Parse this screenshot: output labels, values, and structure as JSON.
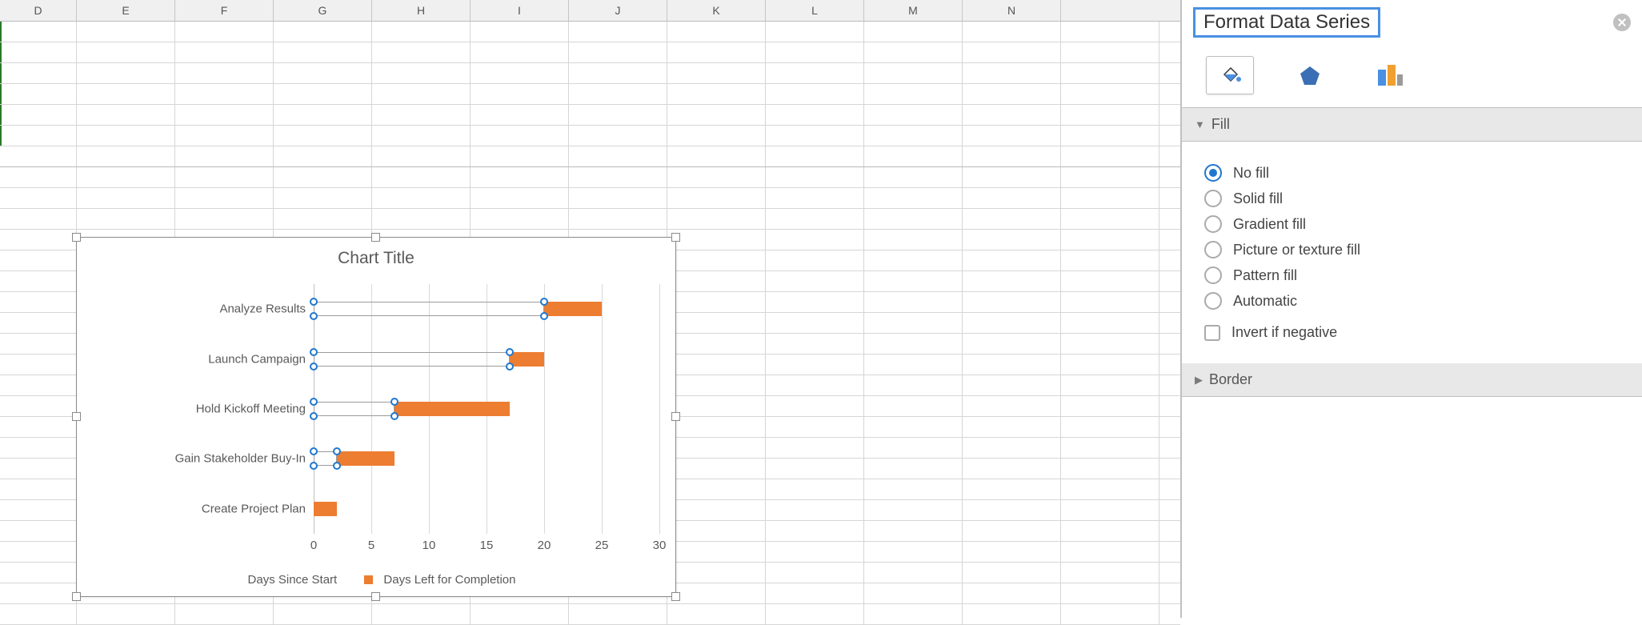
{
  "columns": [
    "D",
    "E",
    "F",
    "G",
    "H",
    "I",
    "J",
    "K",
    "L",
    "M",
    "N"
  ],
  "chart": {
    "title": "Chart Title",
    "legend_blank": "Days Since Start",
    "legend_orange": "Days Left for Completion"
  },
  "chart_data": {
    "type": "bar",
    "orientation": "horizontal",
    "categories": [
      "Analyze Results",
      "Launch Campaign",
      "Hold Kickoff Meeting",
      "Gain Stakeholder Buy-In",
      "Create Project Plan"
    ],
    "series": [
      {
        "name": "Days Since Start",
        "values": [
          20,
          17,
          7,
          2,
          0
        ]
      },
      {
        "name": "Days Left for Completion",
        "values": [
          5,
          3,
          10,
          5,
          2
        ]
      }
    ],
    "xlabel": "",
    "ylabel": "",
    "x_ticks": [
      0,
      5,
      10,
      15,
      20,
      25,
      30
    ],
    "xlim": [
      0,
      30
    ],
    "stacked": true,
    "selected_series": 0,
    "colors": {
      "orange": "#ed7d31"
    }
  },
  "pane": {
    "title": "Format Data Series",
    "section_fill": "Fill",
    "section_border": "Border",
    "fill_options": {
      "no_fill": "No fill",
      "solid_fill": "Solid fill",
      "gradient_fill": "Gradient fill",
      "picture_fill": "Picture or texture fill",
      "pattern_fill": "Pattern fill",
      "automatic": "Automatic"
    },
    "invert_label": "Invert if negative",
    "selected_fill": "no_fill"
  }
}
